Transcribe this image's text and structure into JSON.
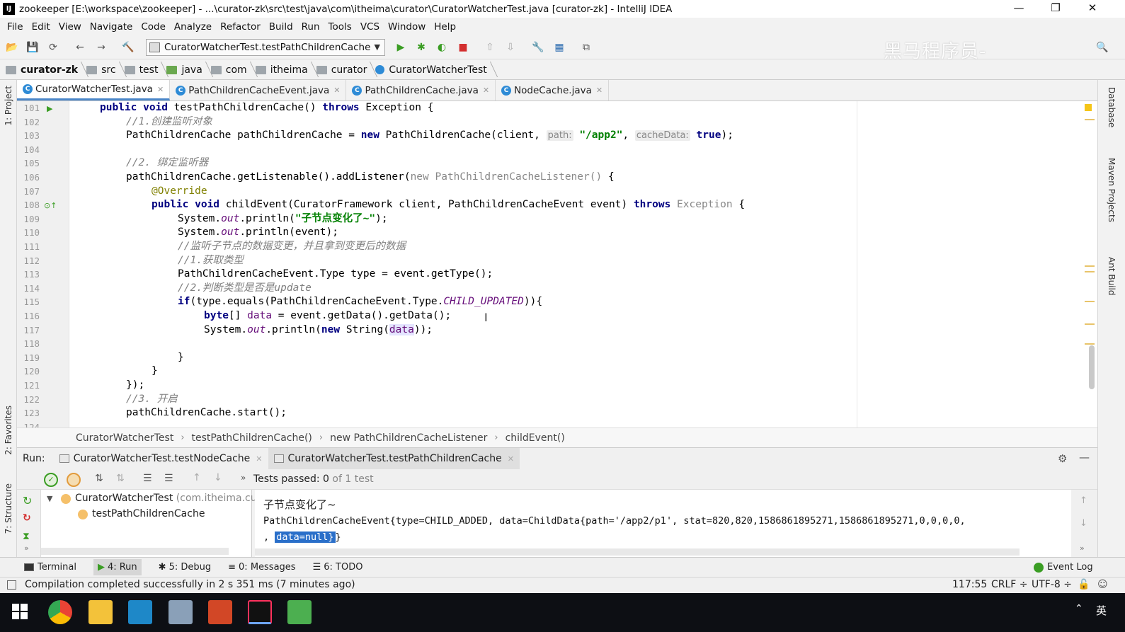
{
  "window": {
    "title": "zookeeper [E:\\workspace\\zookeeper] - ...\\curator-zk\\src\\test\\java\\com\\itheima\\curator\\CuratorWatcherTest.java [curator-zk] - IntelliJ IDEA",
    "app_logo": "IJ"
  },
  "menu": [
    "File",
    "Edit",
    "View",
    "Navigate",
    "Code",
    "Analyze",
    "Refactor",
    "Build",
    "Run",
    "Tools",
    "VCS",
    "Window",
    "Help"
  ],
  "toolbar": {
    "run_config": "CuratorWatcherTest.testPathChildrenCache",
    "watermark": "黑马程序员-"
  },
  "breadcrumb": [
    "curator-zk",
    "src",
    "test",
    "java",
    "com",
    "itheima",
    "curator",
    "CuratorWatcherTest"
  ],
  "editor_tabs": [
    {
      "label": "CuratorWatcherTest.java",
      "active": true
    },
    {
      "label": "PathChildrenCacheEvent.java",
      "active": false
    },
    {
      "label": "PathChildrenCache.java",
      "active": false
    },
    {
      "label": "NodeCache.java",
      "active": false
    }
  ],
  "left_tools": [
    "1: Project",
    "2: Favorites",
    "7: Structure"
  ],
  "right_tools": [
    "Database",
    "Maven Projects",
    "Ant Build"
  ],
  "line_numbers": [
    "101",
    "102",
    "103",
    "104",
    "105",
    "106",
    "107",
    "108",
    "109",
    "110",
    "111",
    "112",
    "113",
    "114",
    "115",
    "116",
    "117",
    "118",
    "119",
    "120",
    "121",
    "122",
    "123",
    "124"
  ],
  "code": {
    "l101": {
      "kw1": "public void ",
      "name": "testPathChildrenCache() ",
      "kw2": "throws ",
      "rest": "Exception {"
    },
    "l102": "//1.创建监听对象",
    "l103": {
      "a": "PathChildrenCache pathChildrenCache = ",
      "kw": "new ",
      "b": "PathChildrenCache(client, ",
      "hint1": "path:",
      "str": "\"/app2\"",
      ",": ", ",
      "hint2": "cacheData:",
      "kw2": "true",
      "end": ");"
    },
    "l105": "//2. 绑定监听器",
    "l106": {
      "a": "pathChildrenCache.getListenable().addListener(",
      "gray": "new PathChildrenCacheListener() ",
      "end": "{"
    },
    "l107": "@Override",
    "l108": {
      "kw1": "public void ",
      "a": "childEvent(CuratorFramework client, PathChildrenCacheEvent event) ",
      "kw2": "throws ",
      "gray": "Exception ",
      "end": "{"
    },
    "l109": {
      "a": "System.",
      "fi": "out",
      "b": ".println(",
      "str": "\"子节点变化了~\"",
      "end": ");"
    },
    "l110": {
      "a": "System.",
      "fi": "out",
      "b": ".println(event);"
    },
    "l111": "//监听子节点的数据变更，并且拿到变更后的数据",
    "l112": "//1.获取类型",
    "l113": "PathChildrenCacheEvent.Type type = event.getType();",
    "l114": "//2.判断类型是否是update",
    "l115": {
      "kw": "if",
      "a": "(type.equals(PathChildrenCacheEvent.Type.",
      "fi": "CHILD_UPDATED",
      "end": ")){"
    },
    "l116": {
      "kw": "byte",
      "a": "[] ",
      "var": "data",
      "b": " = event.getData().getData();"
    },
    "l117": {
      "a": "System.",
      "fi": "out",
      "b": ".println(",
      "kw": "new ",
      "c": "String(",
      "var": "data",
      "end": "));"
    },
    "l119": "}",
    "l120": "}",
    "l121": "});",
    "l122": "//3. 开启",
    "l123": "pathChildrenCache.start();"
  },
  "code_breadcrumb": [
    "CuratorWatcherTest",
    "testPathChildrenCache()",
    "new PathChildrenCacheListener",
    "childEvent()"
  ],
  "run_panel": {
    "label": "Run:",
    "tabs": [
      {
        "label": "CuratorWatcherTest.testNodeCache",
        "active": false
      },
      {
        "label": "CuratorWatcherTest.testPathChildrenCache",
        "active": true
      }
    ],
    "tests_passed_label": "Tests passed: ",
    "tests_passed_count": "0",
    "tests_of": "of 1 test",
    "tree_root": "CuratorWatcherTest",
    "tree_root_pkg": "(com.itheima.cur",
    "tree_child": "testPathChildrenCache",
    "console_lines": [
      "子节点变化了~",
      "PathChildrenCacheEvent{type=CHILD_ADDED, data=ChildData{path='/app2/p1', stat=820,820,1586861895271,1586861895271,0,0,0,0,"
    ],
    "console_line3_prefix": ", ",
    "console_selected": "data=null}",
    "console_line3_end": "}"
  },
  "bottom_tabs": [
    {
      "label": "Terminal"
    },
    {
      "label": "4: Run"
    },
    {
      "label": "5: Debug"
    },
    {
      "label": "0: Messages"
    },
    {
      "label": "6: TODO"
    }
  ],
  "event_log": "Event Log",
  "status": {
    "message": "Compilation completed successfully in 2 s 351 ms (7 minutes ago)",
    "position": "117:55",
    "line_sep": "CRLF ÷",
    "encoding": "UTF-8 ÷"
  },
  "taskbar": {
    "lang": "英"
  },
  "colors": {
    "accent": "#4a86c8",
    "keyword": "#000080",
    "string": "#008000",
    "comment": "#808080",
    "field": "#660e7a",
    "current_line": "#fffae3"
  }
}
